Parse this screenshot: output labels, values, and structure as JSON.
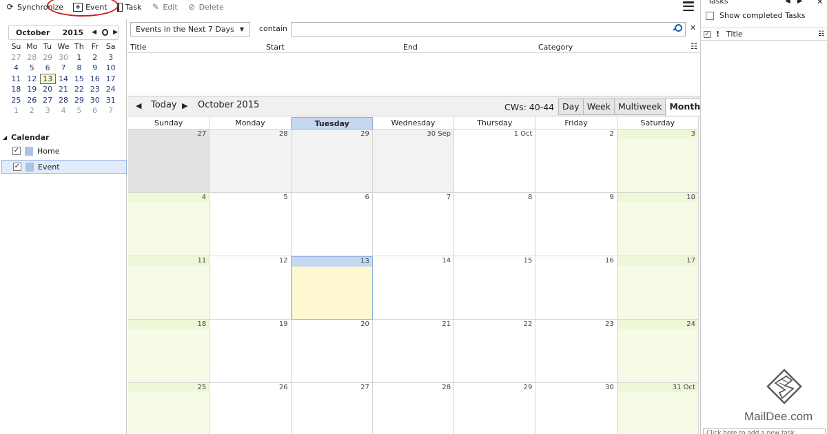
{
  "toolbar": {
    "synchronize": "Synchronize",
    "event": "Event",
    "task": "Task",
    "edit": "Edit",
    "delete": "Delete"
  },
  "minical": {
    "month": "October",
    "year": "2015",
    "weekday_headers": [
      "Su",
      "Mo",
      "Tu",
      "We",
      "Th",
      "Fr",
      "Sa"
    ],
    "weeks": [
      [
        {
          "d": "27",
          "dim": true
        },
        {
          "d": "28",
          "dim": true
        },
        {
          "d": "29",
          "dim": true
        },
        {
          "d": "30",
          "dim": true
        },
        {
          "d": "1"
        },
        {
          "d": "2"
        },
        {
          "d": "3"
        }
      ],
      [
        {
          "d": "4"
        },
        {
          "d": "5"
        },
        {
          "d": "6"
        },
        {
          "d": "7"
        },
        {
          "d": "8"
        },
        {
          "d": "9"
        },
        {
          "d": "10"
        }
      ],
      [
        {
          "d": "11"
        },
        {
          "d": "12"
        },
        {
          "d": "13",
          "today": true
        },
        {
          "d": "14"
        },
        {
          "d": "15"
        },
        {
          "d": "16"
        },
        {
          "d": "17"
        }
      ],
      [
        {
          "d": "18"
        },
        {
          "d": "19"
        },
        {
          "d": "20"
        },
        {
          "d": "21"
        },
        {
          "d": "22"
        },
        {
          "d": "23"
        },
        {
          "d": "24"
        }
      ],
      [
        {
          "d": "25"
        },
        {
          "d": "26"
        },
        {
          "d": "27"
        },
        {
          "d": "28"
        },
        {
          "d": "29"
        },
        {
          "d": "30"
        },
        {
          "d": "31"
        }
      ],
      [
        {
          "d": "1",
          "dim": true
        },
        {
          "d": "2",
          "dim": true
        },
        {
          "d": "3",
          "dim": true
        },
        {
          "d": "4",
          "dim": true
        },
        {
          "d": "5",
          "dim": true
        },
        {
          "d": "6",
          "dim": true
        },
        {
          "d": "7",
          "dim": true
        }
      ]
    ]
  },
  "calendars": {
    "header": "Calendar",
    "items": [
      {
        "label": "Home",
        "checked": true,
        "selected": false
      },
      {
        "label": "Event",
        "checked": true,
        "selected": true
      }
    ]
  },
  "filter": {
    "selected": "Events in the Next 7 Days",
    "contain_label": "contain",
    "search_value": ""
  },
  "event_list": {
    "columns": [
      "Title",
      "Start",
      "End",
      "Category"
    ]
  },
  "cal_nav": {
    "today": "Today",
    "month_label": "October 2015",
    "cws": "CWs: 40-44",
    "views": [
      "Day",
      "Week",
      "Multiweek",
      "Month"
    ],
    "active_view": "Month"
  },
  "month_view": {
    "weekdays": [
      "Sunday",
      "Monday",
      "Tuesday",
      "Wednesday",
      "Thursday",
      "Friday",
      "Saturday"
    ],
    "today_weekday_index": 2,
    "weeks": [
      [
        {
          "label": "27",
          "kind": "other-dark"
        },
        {
          "label": "28",
          "kind": "other"
        },
        {
          "label": "29",
          "kind": "other"
        },
        {
          "label": "30 Sep",
          "kind": "other"
        },
        {
          "label": "1 Oct",
          "kind": "normal"
        },
        {
          "label": "2",
          "kind": "normal"
        },
        {
          "label": "3",
          "kind": "weekend"
        }
      ],
      [
        {
          "label": "4",
          "kind": "weekend"
        },
        {
          "label": "5",
          "kind": "normal"
        },
        {
          "label": "6",
          "kind": "normal"
        },
        {
          "label": "7",
          "kind": "normal"
        },
        {
          "label": "8",
          "kind": "normal"
        },
        {
          "label": "9",
          "kind": "normal"
        },
        {
          "label": "10",
          "kind": "weekend"
        }
      ],
      [
        {
          "label": "11",
          "kind": "weekend"
        },
        {
          "label": "12",
          "kind": "normal"
        },
        {
          "label": "13",
          "kind": "today"
        },
        {
          "label": "14",
          "kind": "normal"
        },
        {
          "label": "15",
          "kind": "normal"
        },
        {
          "label": "16",
          "kind": "normal"
        },
        {
          "label": "17",
          "kind": "weekend"
        }
      ],
      [
        {
          "label": "18",
          "kind": "weekend"
        },
        {
          "label": "19",
          "kind": "normal"
        },
        {
          "label": "20",
          "kind": "normal"
        },
        {
          "label": "21",
          "kind": "normal"
        },
        {
          "label": "22",
          "kind": "normal"
        },
        {
          "label": "23",
          "kind": "normal"
        },
        {
          "label": "24",
          "kind": "weekend"
        }
      ],
      [
        {
          "label": "25",
          "kind": "weekend"
        },
        {
          "label": "26",
          "kind": "normal"
        },
        {
          "label": "27",
          "kind": "normal"
        },
        {
          "label": "28",
          "kind": "normal"
        },
        {
          "label": "29",
          "kind": "normal"
        },
        {
          "label": "30",
          "kind": "normal"
        },
        {
          "label": "31 Oct",
          "kind": "weekend"
        }
      ]
    ]
  },
  "tasks": {
    "title": "Tasks",
    "show_completed": "Show completed Tasks",
    "column_title": "Title",
    "quick_add_placeholder": "Click here to add a new task"
  },
  "watermark": {
    "text": "MailDee.com"
  },
  "colors": {
    "today_highlight": "#fdf8d2",
    "today_header": "#c5d8f0",
    "weekend": "#f5fbe6",
    "annotation_circle": "#c81e1e",
    "calendar_swatch": "#a8c3e6"
  }
}
